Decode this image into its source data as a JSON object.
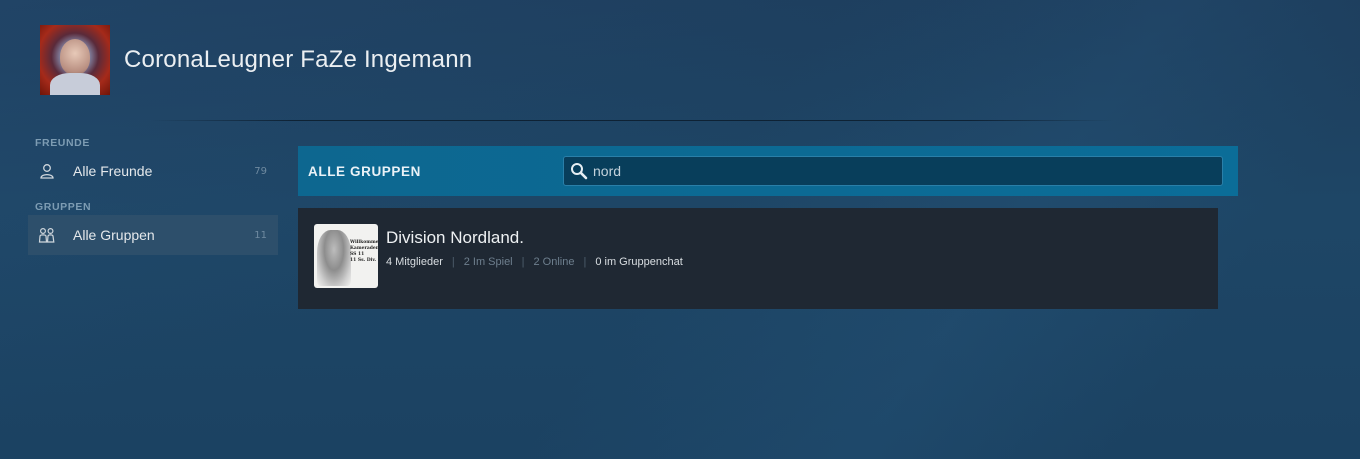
{
  "profile": {
    "username": "CoronaLeugner FaZe Ingemann"
  },
  "sidebar": {
    "sections": [
      {
        "title": "FREUNDE",
        "items": [
          {
            "label": "Alle Freunde",
            "count": "79",
            "icon": "person-icon"
          }
        ]
      },
      {
        "title": "GRUPPEN",
        "items": [
          {
            "label": "Alle Gruppen",
            "count": "11",
            "icon": "group-icon",
            "active": true
          }
        ]
      }
    ]
  },
  "groups_panel": {
    "title": "ALLE GRUPPEN",
    "search": {
      "value": "nord",
      "icon": "search-icon"
    },
    "results": [
      {
        "name": "Division Nordland.",
        "members": "4 Mitglieder",
        "in_game": "2 Im Spiel",
        "online": "2 Online",
        "in_chat": "0 im Gruppenchat",
        "avatar_text": "Willkommen\nKameraden!\nSS 11\n11 Ss. Div."
      }
    ]
  },
  "colors": {
    "accent": "#0b6d98",
    "card": "#1f2833",
    "active_nav": "#2d4f6b"
  }
}
